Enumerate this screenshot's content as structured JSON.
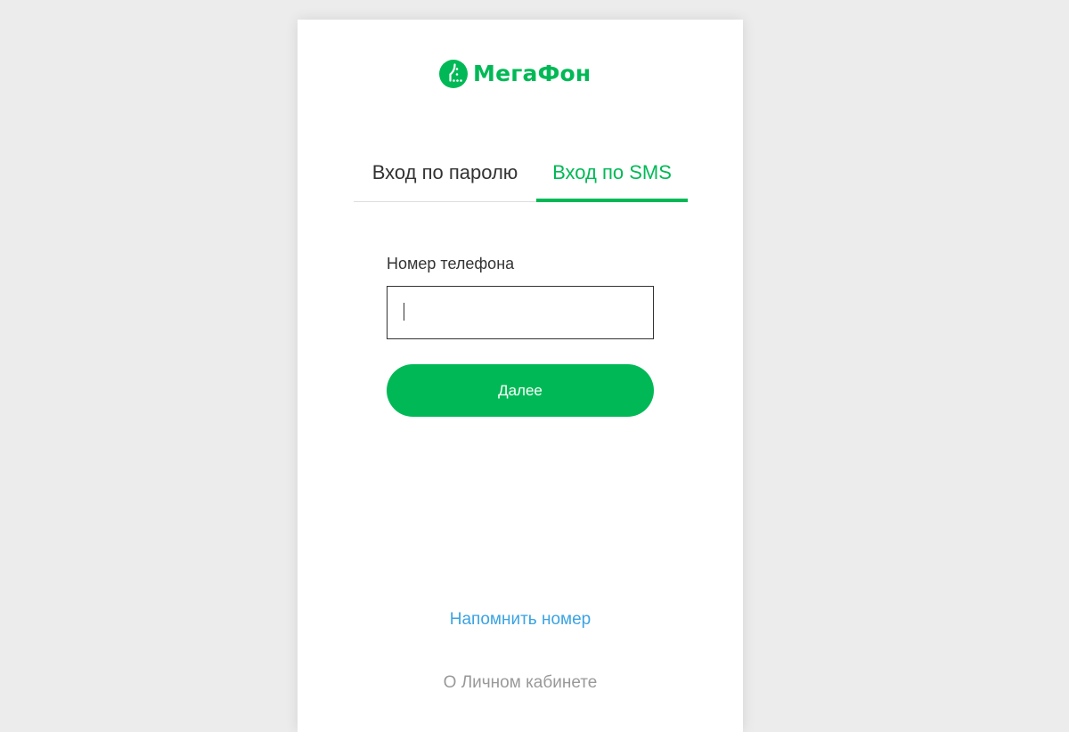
{
  "brand": {
    "name": "МегаФон",
    "color": "#00b956",
    "icon": "megafon-logo-icon"
  },
  "tabs": [
    {
      "label": "Вход по паролю",
      "active": false
    },
    {
      "label": "Вход по SMS",
      "active": true
    }
  ],
  "form": {
    "phone_label": "Номер телефона",
    "phone_value": "",
    "phone_placeholder": "",
    "submit_label": "Далее"
  },
  "links": {
    "remind_number": "Напомнить номер",
    "about_cabinet": "О Личном кабинете"
  },
  "colors": {
    "accent": "#00b956",
    "link": "#3aa3e3",
    "muted": "#999999",
    "background": "#ececec"
  }
}
